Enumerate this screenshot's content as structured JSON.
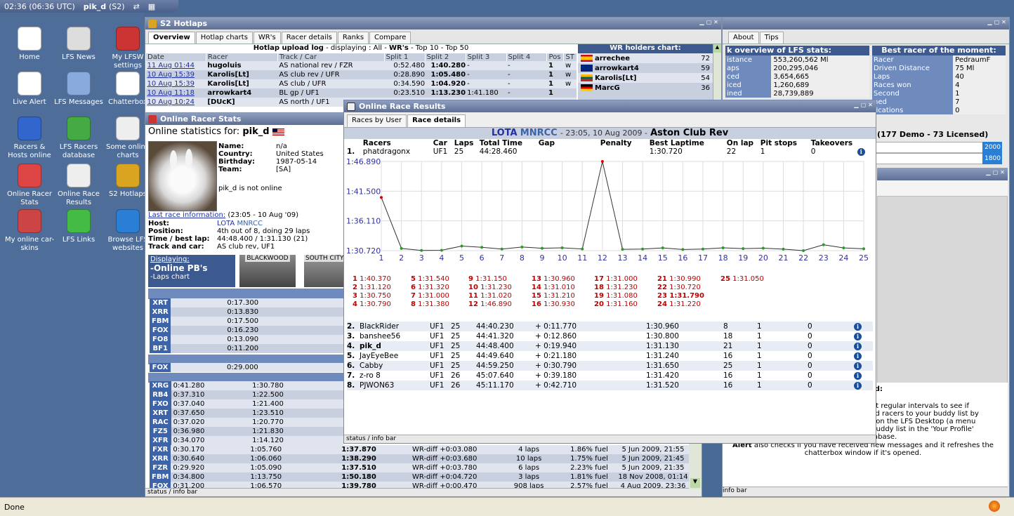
{
  "topbar": {
    "time": "02:36 (06:36 UTC)",
    "user": "pik_d",
    "server": "(S2)"
  },
  "desktop_icons": [
    {
      "label": "Home",
      "icon": "home-icon",
      "color": "#ffffff"
    },
    {
      "label": "LFS News",
      "icon": "newspaper-icon",
      "color": "#dddddd"
    },
    {
      "label": "My LFSW settings",
      "icon": "tools-icon",
      "color": "#cc3333"
    },
    {
      "label": "Live Alert",
      "icon": "bell-icon",
      "color": "#ffffff"
    },
    {
      "label": "LFS Messages",
      "icon": "envelope-icon",
      "color": "#88aadd"
    },
    {
      "label": "Chatterbox",
      "icon": "speech-bubble-icon",
      "color": "#ffffff"
    },
    {
      "label": "Racers & Hosts online",
      "icon": "globe-icon",
      "color": "#3366cc"
    },
    {
      "label": "LFS Racers database",
      "icon": "people-icon",
      "color": "#44aa44"
    },
    {
      "label": "Some online charts",
      "icon": "cup-icon",
      "color": "#eeeeee"
    },
    {
      "label": "Online Racer Stats",
      "icon": "bar-chart-icon",
      "color": "#dd4444"
    },
    {
      "label": "Online Race Results",
      "icon": "checkered-flag-icon",
      "color": "#eeeeee"
    },
    {
      "label": "S2 Hotlaps",
      "icon": "trophy-icon",
      "color": "#d9a520"
    },
    {
      "label": "My online car-skins",
      "icon": "car-icon",
      "color": "#cc4444"
    },
    {
      "label": "LFS Links",
      "icon": "plug-icon",
      "color": "#44bb44"
    },
    {
      "label": "Browse LFS websites",
      "icon": "v-logo-icon",
      "color": "#2a7fd4"
    }
  ],
  "hotlaps": {
    "title": "S2 Hotlaps",
    "tabs": [
      "Overview",
      "Hotlap charts",
      "WR's",
      "Racer details",
      "Ranks",
      "Compare"
    ],
    "upload_title": "Hotlap upload log",
    "upload_sub": "- displaying :",
    "filter_all": "All",
    "filter_sep": "-",
    "filter_wrs": "WR's",
    "filter_top10": "Top 10",
    "filter_top50": "Top 50",
    "headers": [
      "Date",
      "Racer",
      "Track / Car",
      "Split 1",
      "Split 2",
      "Split 3",
      "Split 4",
      "Pos",
      "ST"
    ],
    "rows": [
      [
        "11 Aug 01:44",
        "hugoluis",
        "AS national rev / FZR",
        "0:52.480",
        "1:40.280",
        "-",
        "-",
        "1",
        "w"
      ],
      [
        "10 Aug 15:39",
        "Karolis[Lt]",
        "AS club rev / UFR",
        "0:28.890",
        "1:05.480",
        "-",
        "-",
        "1",
        "w"
      ],
      [
        "10 Aug 15:39",
        "Karolis[Lt]",
        "AS club / UFR",
        "0:34.590",
        "1:04.920",
        "-",
        "-",
        "1",
        "w"
      ],
      [
        "10 Aug 11:18",
        "arrowkart4",
        "BL gp / UF1",
        "0:23.510",
        "1:13.230",
        "1:41.180",
        "-",
        "1",
        ""
      ],
      [
        "10 Aug 10:24",
        "[DUcK]",
        "AS north / UF1",
        "",
        "",
        "",
        "",
        "",
        ""
      ]
    ],
    "wr_title": "WR holders chart:",
    "wr": [
      {
        "name": "arrechee",
        "count": "72",
        "flag": "spain"
      },
      {
        "name": "arrowkart4",
        "count": "59",
        "flag": "australia"
      },
      {
        "name": "Karolis[Lt]",
        "count": "54",
        "flag": "lithuania"
      },
      {
        "name": "MarcG",
        "count": "36",
        "flag": "germany"
      }
    ]
  },
  "lfsstats": {
    "tabs": [
      "About",
      "Tips"
    ],
    "title": "k overview of LFS stats:",
    "rows": [
      [
        "istance",
        "553,260,562 Ml"
      ],
      [
        "aps",
        "200,295,046"
      ],
      [
        "ced",
        "3,654,665"
      ],
      [
        "iced",
        "1,260,689"
      ],
      [
        "ined",
        "28,739,889"
      ]
    ],
    "best_title": "Best racer of the moment:",
    "best": [
      [
        "Racer",
        "PedraumF"
      ],
      [
        "Driven Distance",
        "75 Ml"
      ],
      [
        "Laps",
        "40"
      ],
      [
        "Races won",
        "4"
      ],
      [
        "Second",
        "1"
      ],
      [
        "ned",
        "7"
      ],
      [
        "fications",
        "0"
      ]
    ],
    "demo": "(177 Demo - 73 Licensed)",
    "n2000": "2000",
    "n1800": "1800",
    "alert_head": "ed:",
    "alert_lines": [
      "t at regular intervals to see if",
      "add racers to your buddy list by",
      "re on the LFS Desktop (a menu",
      "r buddy list in the 'Your Profile'",
      "atabase."
    ],
    "alert_bold": "Alert",
    "alert_rest": "also checks if you have received new messages and it refreshes the chatterbox window if it's opened.",
    "infobar": "info bar"
  },
  "racerstats": {
    "title": "Online Racer Stats",
    "for_label": "Online statistics for:",
    "user": "pik_d",
    "fields": [
      [
        "Name:",
        "n/a"
      ],
      [
        "Country:",
        "United States"
      ],
      [
        "Birthday:",
        "1987-05-14"
      ],
      [
        "Team:",
        "[SA]"
      ]
    ],
    "status": "pik_d is not online",
    "last_label": "Last race information:",
    "last_when": "(23:05 - 10 Aug '09)",
    "host_label": "Host:",
    "host_name": "LOTA",
    "host_rest": "MNRCC",
    "details": [
      [
        "Position:",
        "4th out of 8, doing 29 laps"
      ],
      [
        "Time / best lap:",
        "44:48.400 / 1:31.130 (21)"
      ],
      [
        "Track and car:",
        "AS club rev, UF1"
      ]
    ],
    "displaying": "Displaying:",
    "pb": "-Online PB's",
    "laps": "-Laps chart",
    "tracks": [
      "BLACKWOOD",
      "SOUTH CITY"
    ],
    "pb1": [
      [
        "XRT",
        "0:17.300"
      ],
      [
        "XRR",
        "0:13.830"
      ],
      [
        "FBM",
        "0:17.500"
      ],
      [
        "FOX",
        "0:16.230"
      ],
      [
        "FO8",
        "0:13.090"
      ],
      [
        "BF1",
        "0:11.200"
      ]
    ],
    "pb2": [
      [
        "FOX",
        "0:29.000"
      ]
    ],
    "pb3": [
      [
        "XRG",
        "0:41.280",
        "1:30.780"
      ],
      [
        "RB4",
        "0:37.310",
        "1:22.500"
      ],
      [
        "FXO",
        "0:37.040",
        "1:21.400"
      ],
      [
        "XRT",
        "0:37.650",
        "1:23.510"
      ],
      [
        "RAC",
        "0:37.020",
        "1:20.770"
      ],
      [
        "FZ5",
        "0:36.980",
        "1:21.830"
      ],
      [
        "XFR",
        "0:34.070",
        "1:14.120"
      ]
    ],
    "pb4": [
      [
        "FXR",
        "0:30.170",
        "1:05.760",
        "1:37.870",
        "WR-diff +0:03.080",
        "4 laps",
        "1.86% fuel",
        "5 Jun 2009, 21:55"
      ],
      [
        "XRR",
        "0:30.640",
        "1:06.060",
        "1:38.290",
        "WR-diff +0:03.680",
        "10 laps",
        "1.75% fuel",
        "5 Jun 2009, 21:45"
      ],
      [
        "FZR",
        "0:29.920",
        "1:05.090",
        "1:37.510",
        "WR-diff +0:03.780",
        "6 laps",
        "2.23% fuel",
        "5 Jun 2009, 21:35"
      ],
      [
        "FBM",
        "0:34.800",
        "1:13.750",
        "1:50.180",
        "WR-diff +0:04.720",
        "3 laps",
        "1.81% fuel",
        "18 Nov 2008, 01:14"
      ],
      [
        "FOX",
        "0:31.200",
        "1:06.570",
        "1:39.780",
        "WR-diff +0:00.470",
        "908 laps",
        "2.57% fuel",
        "4 Aug 2009, 23:36"
      ]
    ],
    "statusbar": "status / info bar"
  },
  "raceresults": {
    "title": "Online Race Results",
    "tabs": [
      "Races by User",
      "Race details"
    ],
    "host": "LOTA",
    "host2": "MNRCC",
    "when": "- 23:05, 10 Aug 2009 -",
    "track": "Aston Club Rev",
    "headers": [
      "Racers",
      "Car",
      "Laps",
      "Total Time",
      "Gap",
      "Penalty",
      "Best Laptime",
      "On lap",
      "Pit stops",
      "Takeovers"
    ],
    "first": [
      "1.",
      "phatdragonx",
      "UF1",
      "25",
      "44:28.460",
      "",
      "",
      "1:30.720",
      "22",
      "1",
      "0"
    ],
    "others": [
      [
        "2.",
        "BlackRider",
        "UF1",
        "25",
        "44:40.230",
        "+ 0:11.770",
        "",
        "1:30.960",
        "8",
        "1",
        "0"
      ],
      [
        "3.",
        "banshee56",
        "UF1",
        "25",
        "44:41.320",
        "+ 0:12.860",
        "",
        "1:30.800",
        "18",
        "1",
        "0"
      ],
      [
        "4.",
        "pik_d",
        "UF1",
        "25",
        "44:48.400",
        "+ 0:19.940",
        "",
        "1:31.130",
        "21",
        "1",
        "0"
      ],
      [
        "5.",
        "JayEyeBee",
        "UF1",
        "25",
        "44:49.640",
        "+ 0:21.180",
        "",
        "1:31.240",
        "16",
        "1",
        "0"
      ],
      [
        "6.",
        "Cabby",
        "UF1",
        "25",
        "44:59.250",
        "+ 0:30.790",
        "",
        "1:31.650",
        "25",
        "1",
        "0"
      ],
      [
        "7.",
        "z-ro 8",
        "UF1",
        "26",
        "45:07.640",
        "+ 0:39.180",
        "",
        "1:31.420",
        "16",
        "1",
        "0"
      ],
      [
        "8.",
        "PJWON63",
        "UF1",
        "26",
        "45:11.170",
        "+ 0:42.710",
        "",
        "1:31.520",
        "16",
        "1",
        "0"
      ]
    ],
    "statusbar": "status / info bar"
  },
  "chart_data": {
    "type": "line",
    "x": [
      1,
      2,
      3,
      4,
      5,
      6,
      7,
      8,
      9,
      10,
      11,
      12,
      13,
      14,
      15,
      16,
      17,
      18,
      19,
      20,
      21,
      22,
      23,
      24,
      25
    ],
    "laps": [
      "1:40.370",
      "1:31.120",
      "1:30.750",
      "1:30.790",
      "1:31.540",
      "1:31.320",
      "1:31.000",
      "1:31.380",
      "1:31.150",
      "1:31.230",
      "1:31.020",
      "1:46.890",
      "1:30.960",
      "1:31.010",
      "1:31.210",
      "1:30.930",
      "1:31.000",
      "1:31.230",
      "1:31.080",
      "1:31.160",
      "1:30.990",
      "1:30.720",
      "1:31.790",
      "1:31.220",
      "1:31.050"
    ],
    "values": [
      100.37,
      91.12,
      90.75,
      90.79,
      91.54,
      91.32,
      91.0,
      91.38,
      91.15,
      91.23,
      91.02,
      106.89,
      90.96,
      91.01,
      91.21,
      90.93,
      91.0,
      91.23,
      91.08,
      91.16,
      90.99,
      90.72,
      91.79,
      91.22,
      91.05
    ],
    "ytick_values": [
      106.89,
      101.5,
      96.11,
      90.72
    ],
    "ytick_labels": [
      "1:46.890",
      "1:41.500",
      "1:36.110",
      "1:30.720"
    ],
    "ylim": [
      90.72,
      106.89
    ],
    "grid": true,
    "best_lap_index": 22,
    "line_color": "#333333",
    "marker_color": "#2a9a2a",
    "max_marker_color": "#dd0000"
  },
  "browser": {
    "status": "Done"
  }
}
